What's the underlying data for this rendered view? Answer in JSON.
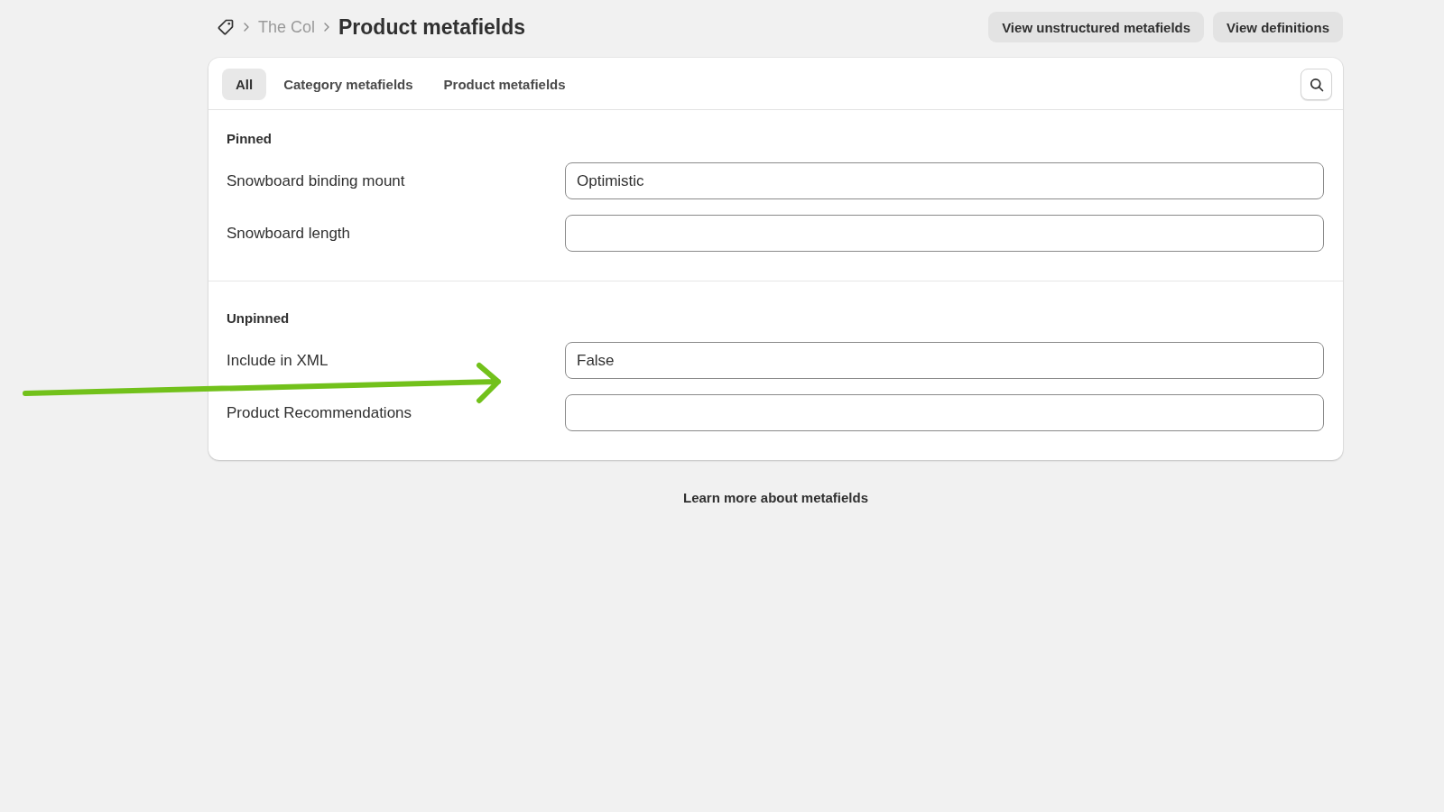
{
  "breadcrumb": {
    "items": [
      {
        "label": "The Col"
      }
    ],
    "title": "Product metafields"
  },
  "header_actions": [
    "View unstructured metafields",
    "View definitions"
  ],
  "tabs": [
    {
      "label": "All",
      "selected": true
    },
    {
      "label": "Category metafields",
      "selected": false
    },
    {
      "label": "Product metafields",
      "selected": false
    }
  ],
  "sections": [
    {
      "title": "Pinned",
      "fields": [
        {
          "label": "Snowboard binding mount",
          "value": "Optimistic"
        },
        {
          "label": "Snowboard length"
        }
      ]
    },
    {
      "title": "Unpinned",
      "fields": [
        {
          "label": "Include in XML",
          "value": "False"
        },
        {
          "label": "Product Recommendations"
        }
      ]
    }
  ],
  "footer_link": "Learn more about metafields",
  "annotations": [
    {
      "kind": "arrow"
    }
  ]
}
